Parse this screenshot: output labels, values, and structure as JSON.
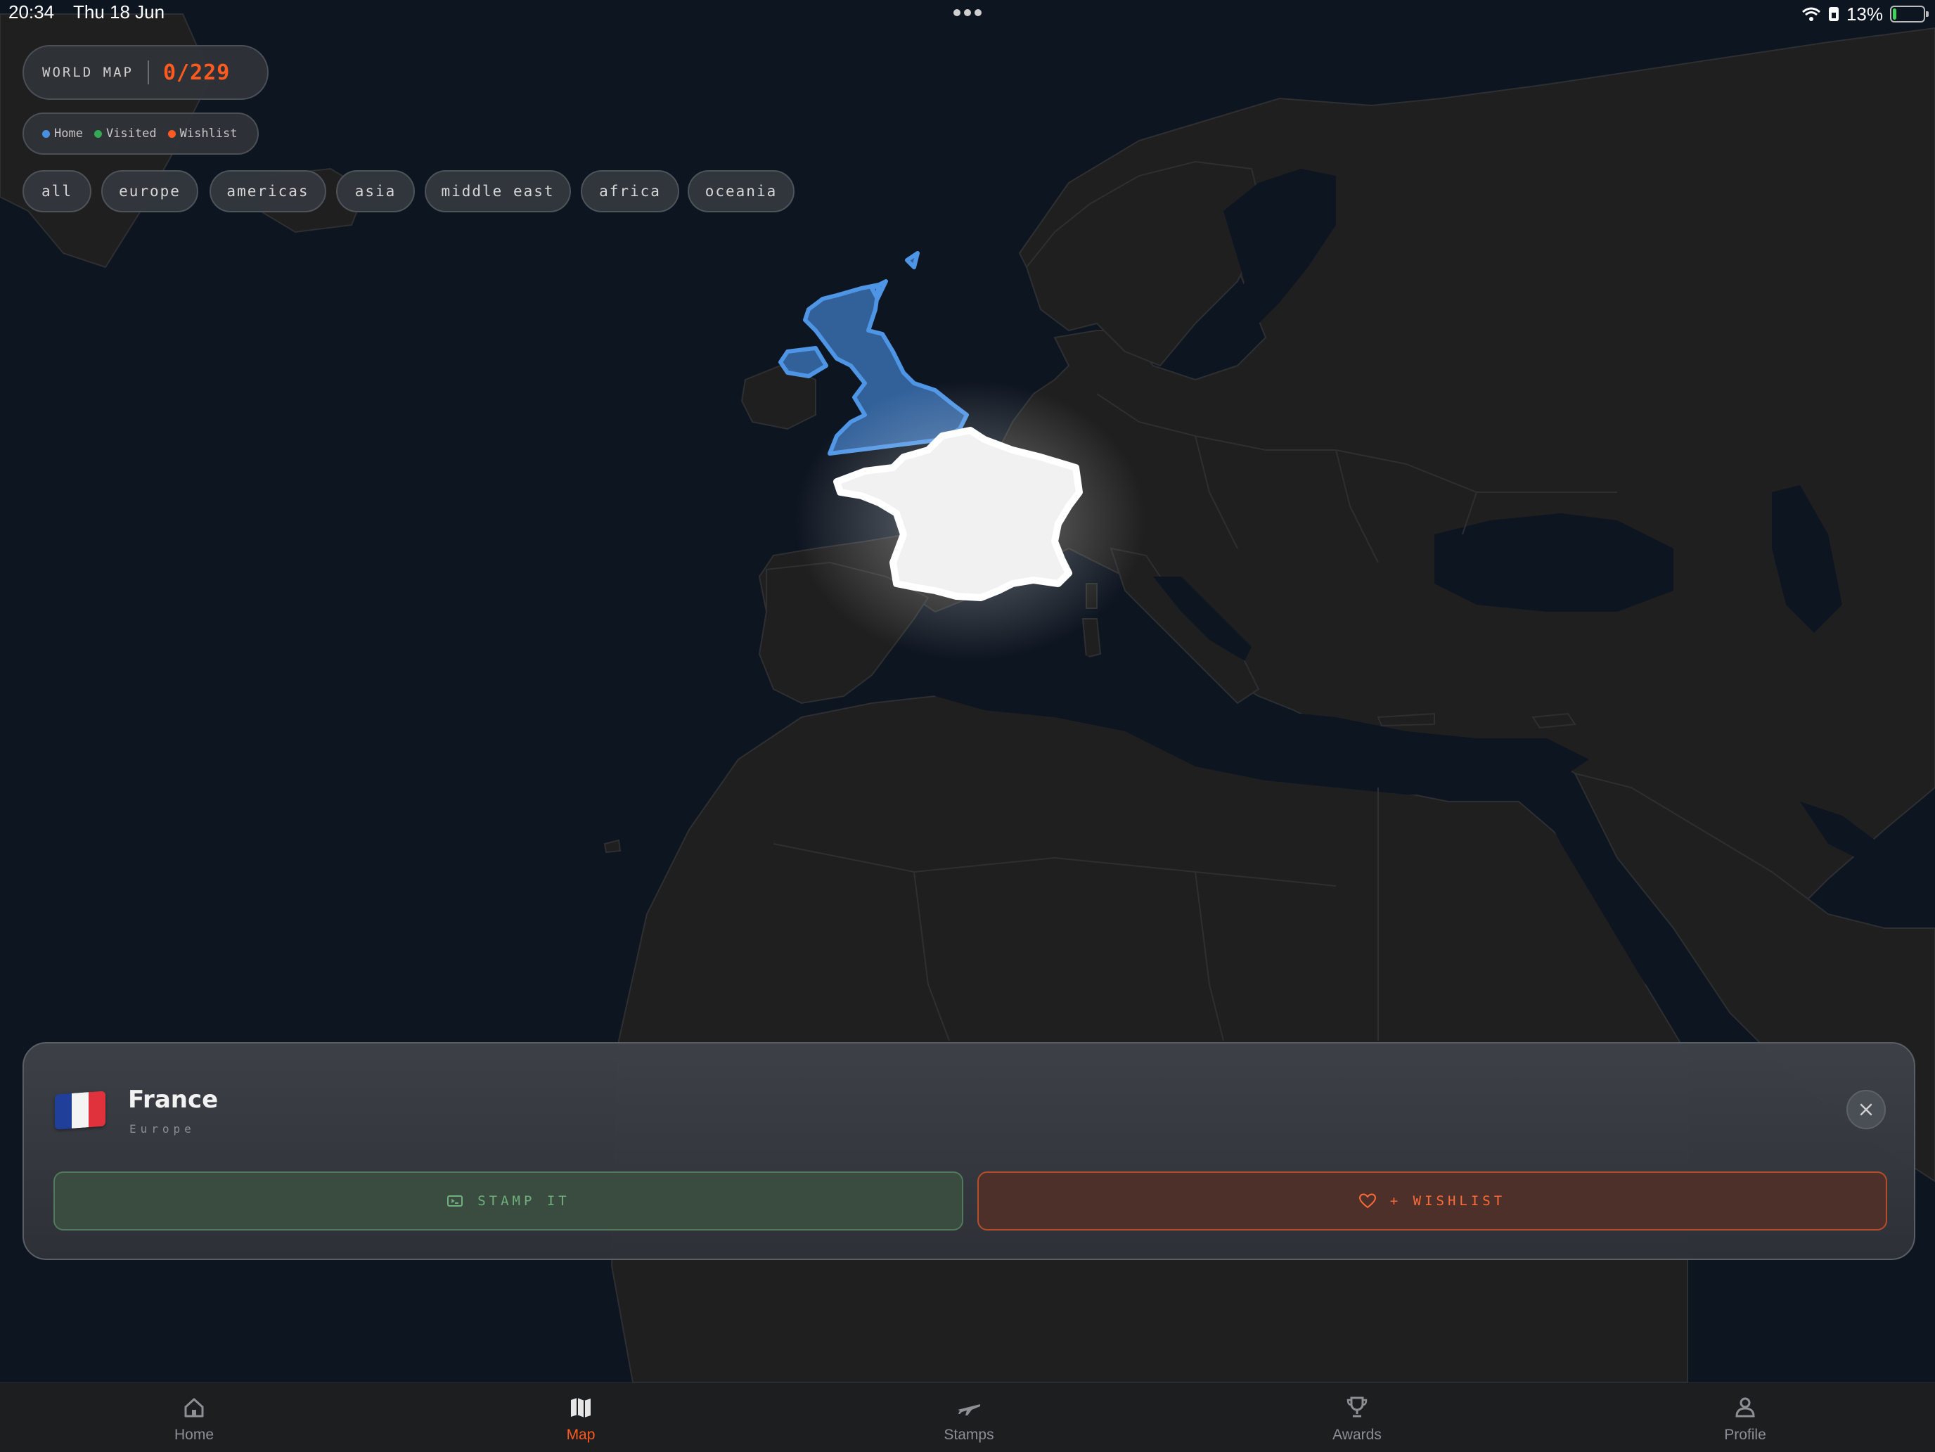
{
  "status_bar": {
    "time": "20:34",
    "date": "Thu 18 Jun",
    "battery_pct": "13%",
    "battery_level": 0.13
  },
  "header": {
    "title": "WORLD MAP",
    "count": "0/229"
  },
  "legend": [
    {
      "label": "Home",
      "color": "#4a90e2"
    },
    {
      "label": "Visited",
      "color": "#34a853"
    },
    {
      "label": "Wishlist",
      "color": "#ff5a1f"
    }
  ],
  "filters": [
    "all",
    "europe",
    "americas",
    "asia",
    "middle east",
    "africa",
    "oceania"
  ],
  "selected_country": {
    "name": "France",
    "region": "Europe",
    "flag_colors": [
      "#1f3f9b",
      "#f4f4f4",
      "#e0323c"
    ],
    "stamp_label": "STAMP IT",
    "wishlist_label": "+ WISHLIST"
  },
  "tabs": [
    {
      "label": "Home",
      "icon": "home-icon"
    },
    {
      "label": "Map",
      "icon": "map-icon",
      "active": true
    },
    {
      "label": "Stamps",
      "icon": "plane-icon"
    },
    {
      "label": "Awards",
      "icon": "trophy-icon"
    },
    {
      "label": "Profile",
      "icon": "person-icon"
    }
  ],
  "colors": {
    "accent": "#ff5a1f",
    "home": "#4a90e2",
    "visited": "#34a853",
    "ocean": "#0d1520",
    "land": "#1f1f20"
  }
}
